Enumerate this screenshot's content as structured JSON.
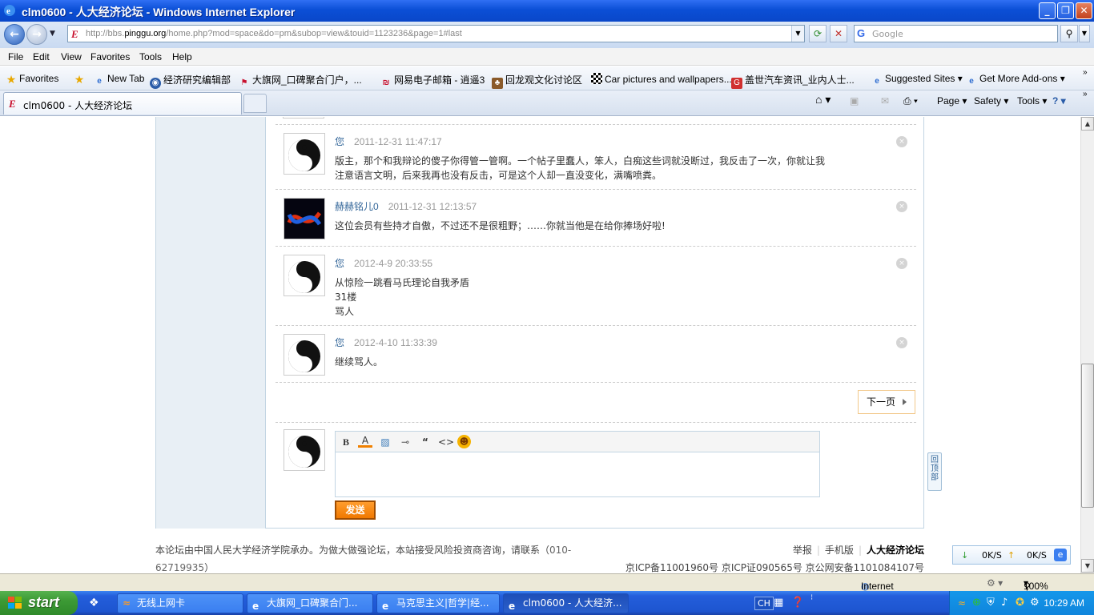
{
  "window": {
    "title": "clm0600 - 人大经济论坛 - Windows Internet Explorer"
  },
  "address": {
    "url_prefix": "http://bbs.",
    "url_domain": "pinggu.org",
    "url_rest": "/home.php?mod=space&do=pm&subop=view&touid=1123236&page=1#last",
    "search_placeholder": "Google"
  },
  "menu": [
    "File",
    "Edit",
    "View",
    "Favorites",
    "Tools",
    "Help"
  ],
  "favorites": {
    "label": "Favorites",
    "items": [
      "New Tab",
      "经济研究编辑部",
      "大旗网_口碑聚合门户，...",
      "网易电子邮箱 - 逍遥3",
      "回龙观文化讨论区",
      "Car pictures and wallpapers...",
      "盖世汽车资讯_业内人士...",
      "Suggested Sites",
      "Get More Add-ons"
    ]
  },
  "tab": {
    "title": "clm0600 - 人大经济论坛"
  },
  "commandbar": {
    "page": "Page",
    "safety": "Safety",
    "tools": "Tools"
  },
  "messages": [
    {
      "author": "您",
      "time": "2011-12-31 11:47:17",
      "lines": [
        "版主，那个和我辩论的傻子你得管一管啊。一个帖子里蠢人，笨人，白痴这些词就没断过，我反击了一次，你就让我",
        "注意语言文明，后来我再也没有反击，可是这个人却一直没变化，满嘴喷粪。"
      ]
    },
    {
      "author": "赫赫铭儿0",
      "time": "2011-12-31 12:13:57",
      "lines": [
        "这位会员有些持才自傲，不过还不是很粗野；……你就当他是在给你捧场好啦!"
      ]
    },
    {
      "author": "您",
      "time": "2012-4-9 20:33:55",
      "lines": [
        "从惊险一跳看马氏理论自我矛盾",
        "31楼",
        "骂人"
      ]
    },
    {
      "author": "您",
      "time": "2012-4-10 11:33:39",
      "lines": [
        "继续骂人。"
      ]
    }
  ],
  "pagination": {
    "next": "下一页"
  },
  "editor": {
    "send": "发送"
  },
  "backtop": "回顶部",
  "footer": {
    "left_text": "本论坛由中国人民大学经济学院承办。为做大做强论坛，本站接受风险投资商咨询，请联系（",
    "phone": "010-62719935",
    "left_close": "）",
    "links": [
      "举报",
      "手机版",
      "人大经济论坛"
    ],
    "icp": "京ICP备11001960号  京ICP证090565号  京公网安备1101084107号"
  },
  "speed": {
    "down": "0K/S",
    "up": "0K/S"
  },
  "status": {
    "zone": "Internet",
    "zoom": "100%"
  },
  "taskbar": {
    "start": "start",
    "tasks": [
      "无线上网卡",
      "大旗网_口碑聚合门...",
      "马克思主义|哲学|经...",
      "clm0600 - 人大经济..."
    ],
    "lang": "CH",
    "clock": "10:29 AM"
  }
}
